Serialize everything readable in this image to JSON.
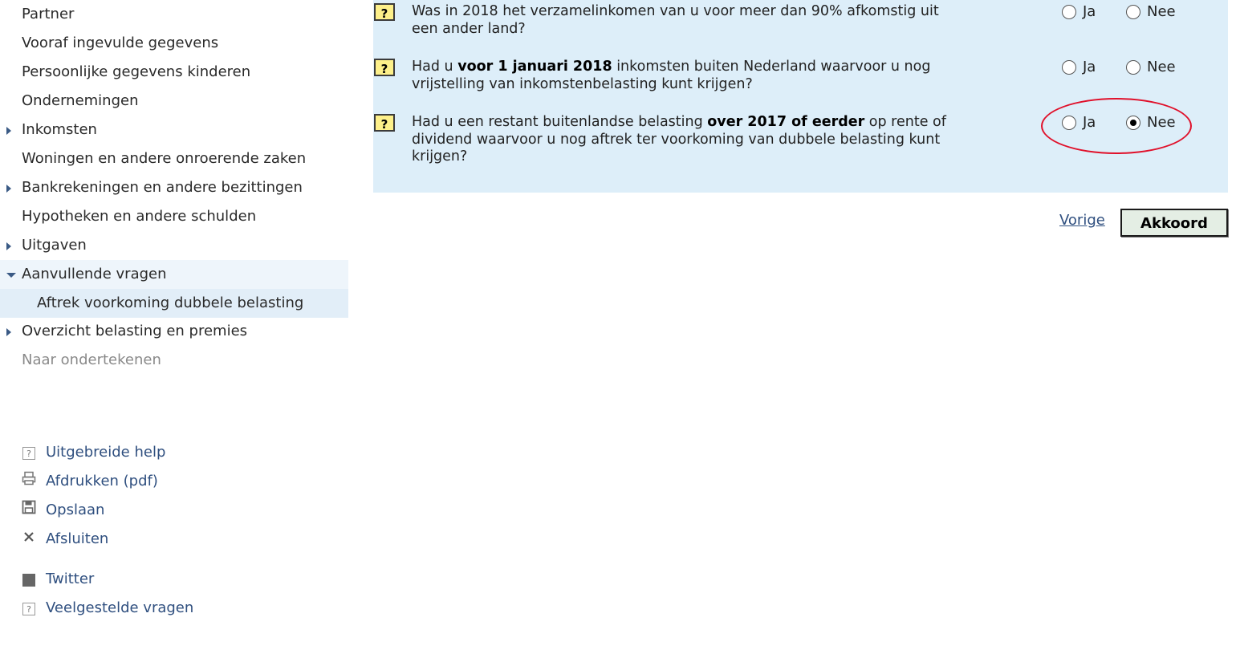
{
  "sidebar": {
    "items": [
      {
        "label": "Partner"
      },
      {
        "label": "Vooraf ingevulde gegevens"
      },
      {
        "label": "Persoonlijke gegevens kinderen"
      },
      {
        "label": "Ondernemingen"
      },
      {
        "label": "Inkomsten"
      },
      {
        "label": "Woningen en andere onroerende zaken"
      },
      {
        "label": "Bankrekeningen en andere bezittingen"
      },
      {
        "label": "Hypotheken en andere schulden"
      },
      {
        "label": "Uitgaven"
      },
      {
        "label": "Aanvullende vragen"
      },
      {
        "label": "Aftrek voorkoming dubbele belasting"
      },
      {
        "label": "Overzicht belasting en premies"
      },
      {
        "label": "Naar ondertekenen"
      }
    ],
    "tools": [
      {
        "label": "Uitgebreide help",
        "icon": "help-icon"
      },
      {
        "label": "Afdrukken (pdf)",
        "icon": "print-icon"
      },
      {
        "label": "Opslaan",
        "icon": "save-icon"
      },
      {
        "label": "Afsluiten",
        "icon": "close-icon"
      },
      {
        "label": "Twitter",
        "icon": "twitter-icon"
      },
      {
        "label": "Veelgestelde vragen",
        "icon": "faq-icon"
      }
    ]
  },
  "questions": [
    {
      "help": "?",
      "text_plain_1": "Was in 2018 het verzamelinkomen van u voor meer dan 90% afkomstig uit een ander land?",
      "yes_label": "Ja",
      "no_label": "Nee",
      "selected": "none"
    },
    {
      "help": "?",
      "text_plain_1": "Had u ",
      "text_bold": "voor 1 januari 2018",
      "text_plain_2": " inkomsten buiten Nederland waarvoor u nog vrijstelling van inkomstenbelasting kunt krijgen?",
      "yes_label": "Ja",
      "no_label": "Nee",
      "selected": "none"
    },
    {
      "help": "?",
      "text_plain_1": "Had u een restant buitenlandse belasting ",
      "text_bold": "over 2017 of eerder",
      "text_plain_2": " op rente of dividend waarvoor u nog aftrek ter voorkoming van dubbele belasting kunt krijgen?",
      "yes_label": "Ja",
      "no_label": "Nee",
      "selected": "Nee"
    }
  ],
  "actions": {
    "prev_label": "Vorige",
    "ok_label": "Akkoord"
  },
  "colors": {
    "panel_background": "#ddeef9",
    "highlight_ellipse": "#e0102a",
    "link": "#2f4f7f",
    "help_button": "#fdf08a"
  }
}
